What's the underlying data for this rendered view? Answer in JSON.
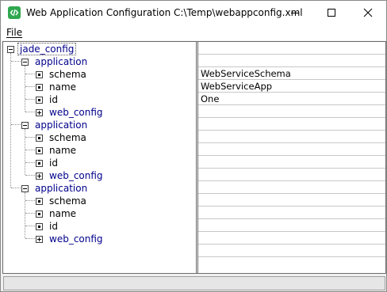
{
  "window": {
    "title": "Web Application Configuration C:\\Temp\\webappconfig.xml",
    "icon": "code-icon"
  },
  "menubar": {
    "file_accel": "F",
    "file_rest": "ile"
  },
  "tree": {
    "root": "jade_config",
    "applications": [
      {
        "label": "application",
        "schema": "schema",
        "name": "name",
        "id": "id",
        "web_config": "web_config"
      },
      {
        "label": "application",
        "schema": "schema",
        "name": "name",
        "id": "id",
        "web_config": "web_config"
      },
      {
        "label": "application",
        "schema": "schema",
        "name": "name",
        "id": "id",
        "web_config": "web_config"
      }
    ]
  },
  "values": {
    "app1_schema": "WebServiceSchema",
    "app1_name": "WebServiceApp",
    "app1_id": "One"
  },
  "colors": {
    "element_text": "#00008b",
    "icon_green": "#2fa84f"
  }
}
